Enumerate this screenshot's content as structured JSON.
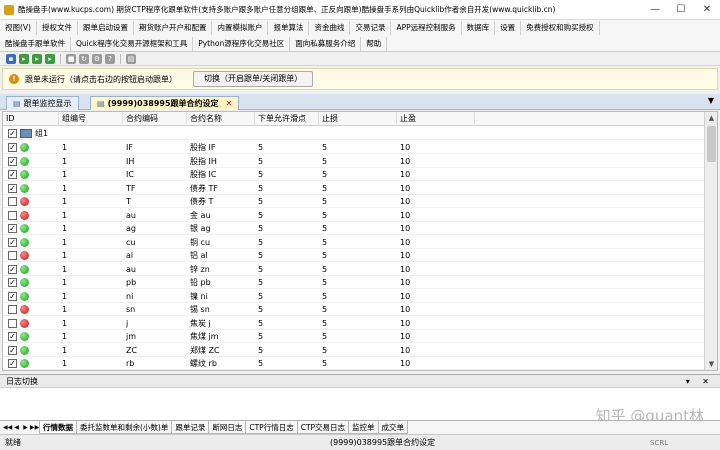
{
  "window": {
    "title": "酷操盘手(www.kucps.com) 期货CTP程序化跟单软件(支持多账户跟多账户任意分组跟单、正反向跟单)酷操盘手系列由Quicklib作者余自开发(www.quicklib.cn)",
    "minimize_glyph": "—",
    "maximize_glyph": "☐",
    "close_glyph": "✕"
  },
  "menu": {
    "row1": [
      "视图(V)",
      "授权文件",
      "跟单启动设置",
      "期货账户开户和配置",
      "内置模拟账户",
      "报单算法",
      "资金曲线",
      "交易记录",
      "APP远程控制服务",
      "数据库",
      "设置",
      "免费授权和购买授权"
    ],
    "row2": [
      "酷操盘手跟单软件",
      "Quick程序化交易开源框架和工具",
      "Python源程序化交易社区",
      "面向私募服务介绍",
      "帮助"
    ]
  },
  "infobar": {
    "message": "跟单未运行（请点击右边的按钮启动跟单）",
    "toggle_button": "切换（开启跟单/关闭跟单）"
  },
  "tabs": {
    "monitor": "跟单监控显示",
    "settings": "(9999)038995跟单合约设定",
    "close_glyph": "✕",
    "dropdown_glyph": "▼"
  },
  "table": {
    "columns": [
      "ID",
      "组编号",
      "合约编码",
      "合约名称",
      "下单允许滑点",
      "止损",
      "止盈"
    ],
    "group_label": "组1",
    "rows": [
      {
        "checked": true,
        "ok": true,
        "group": "1",
        "code": "IF",
        "name": "股指 IF",
        "slip": "5",
        "stop_loss": "5",
        "take_profit": "10"
      },
      {
        "checked": true,
        "ok": true,
        "group": "1",
        "code": "IH",
        "name": "股指 IH",
        "slip": "5",
        "stop_loss": "5",
        "take_profit": "10"
      },
      {
        "checked": true,
        "ok": true,
        "group": "1",
        "code": "IC",
        "name": "股指 IC",
        "slip": "5",
        "stop_loss": "5",
        "take_profit": "10"
      },
      {
        "checked": true,
        "ok": true,
        "group": "1",
        "code": "TF",
        "name": "债券 TF",
        "slip": "5",
        "stop_loss": "5",
        "take_profit": "10"
      },
      {
        "checked": false,
        "ok": false,
        "group": "1",
        "code": "T",
        "name": "债券 T",
        "slip": "5",
        "stop_loss": "5",
        "take_profit": "10"
      },
      {
        "checked": false,
        "ok": false,
        "group": "1",
        "code": "au",
        "name": "金 au",
        "slip": "5",
        "stop_loss": "5",
        "take_profit": "10"
      },
      {
        "checked": true,
        "ok": true,
        "group": "1",
        "code": "ag",
        "name": "银 ag",
        "slip": "5",
        "stop_loss": "5",
        "take_profit": "10"
      },
      {
        "checked": true,
        "ok": true,
        "group": "1",
        "code": "cu",
        "name": "铜 cu",
        "slip": "5",
        "stop_loss": "5",
        "take_profit": "10"
      },
      {
        "checked": false,
        "ok": false,
        "group": "1",
        "code": "al",
        "name": "铝 al",
        "slip": "5",
        "stop_loss": "5",
        "take_profit": "10"
      },
      {
        "checked": true,
        "ok": true,
        "group": "1",
        "code": "au",
        "name": "锌 zn",
        "slip": "5",
        "stop_loss": "5",
        "take_profit": "10"
      },
      {
        "checked": true,
        "ok": true,
        "group": "1",
        "code": "pb",
        "name": "铅 pb",
        "slip": "5",
        "stop_loss": "5",
        "take_profit": "10"
      },
      {
        "checked": true,
        "ok": true,
        "group": "1",
        "code": "ni",
        "name": "镍 ni",
        "slip": "5",
        "stop_loss": "5",
        "take_profit": "10"
      },
      {
        "checked": false,
        "ok": false,
        "group": "1",
        "code": "sn",
        "name": "锡 sn",
        "slip": "5",
        "stop_loss": "5",
        "take_profit": "10"
      },
      {
        "checked": false,
        "ok": false,
        "group": "1",
        "code": "j",
        "name": "焦炭 j",
        "slip": "5",
        "stop_loss": "5",
        "take_profit": "10"
      },
      {
        "checked": true,
        "ok": true,
        "group": "1",
        "code": "jm",
        "name": "焦煤 jm",
        "slip": "5",
        "stop_loss": "5",
        "take_profit": "10"
      },
      {
        "checked": true,
        "ok": true,
        "group": "1",
        "code": "ZC",
        "name": "郑煤 ZC",
        "slip": "5",
        "stop_loss": "5",
        "take_profit": "10"
      },
      {
        "checked": true,
        "ok": true,
        "group": "1",
        "code": "rb",
        "name": "螺纹 rb",
        "slip": "5",
        "stop_loss": "5",
        "take_profit": "10"
      }
    ]
  },
  "log_panel": {
    "title": "日志切换",
    "controls": "▾ ✕"
  },
  "watermark": "知乎 @quant林",
  "bottom_tabs": {
    "nav": [
      "◀◀",
      "◀",
      "▶",
      "▶▶"
    ],
    "items": [
      "行情数据",
      "委托监数单和剩余(小数)单",
      "跟单记录",
      "断网日志",
      "CTP行情日志",
      "CTP交易日志",
      "监控单",
      "成交单"
    ],
    "active_index": 0
  },
  "statusbar": {
    "ready": "就绪",
    "document": "(9999)038995跟单合约设定",
    "scrl": "SCRL"
  },
  "colors": {
    "ok": "#1d9b1d",
    "bad": "#c41414",
    "info_bg": "#fffbe6",
    "active_tab": "#fff6c8"
  }
}
